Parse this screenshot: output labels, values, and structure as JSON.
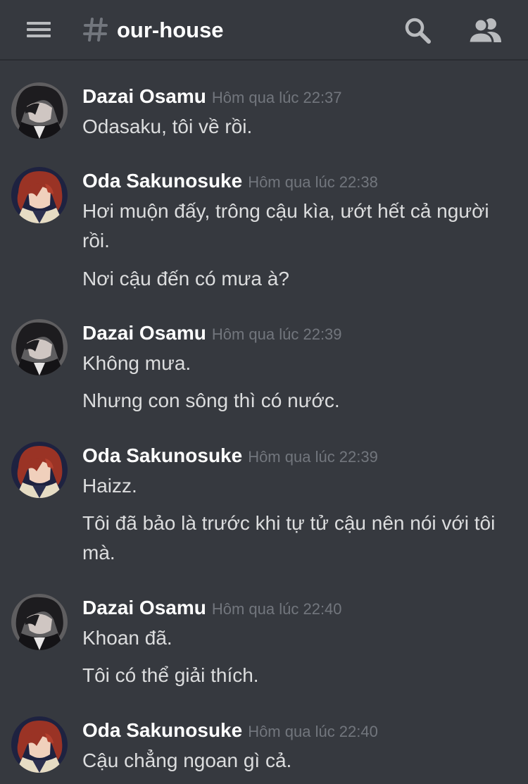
{
  "header": {
    "menu_icon": "hamburger-menu-icon",
    "hash_icon": "hash-icon",
    "channel_name": "our-house",
    "search_icon": "search-icon",
    "members_icon": "members-icon"
  },
  "colors": {
    "background": "#36393f",
    "username": "#ffffff",
    "message_text": "#dcddde",
    "timestamp": "#72767d",
    "header_icons": "#b9bbbe"
  },
  "messages": [
    {
      "author": "Dazai Osamu",
      "avatar": "dazai-avatar",
      "time": "Hôm qua lúc 22:37",
      "lines": [
        "Odasaku, tôi về rồi."
      ]
    },
    {
      "author": "Oda Sakunosuke",
      "avatar": "oda-avatar",
      "time": "Hôm qua lúc 22:38",
      "lines": [
        "Hơi muộn đấy, trông cậu kìa, ướt hết cả người rồi.",
        "Nơi cậu đến có mưa à?"
      ]
    },
    {
      "author": "Dazai Osamu",
      "avatar": "dazai-avatar",
      "time": "Hôm qua lúc 22:39",
      "lines": [
        "Không mưa.",
        "Nhưng con sông thì có nước."
      ]
    },
    {
      "author": "Oda Sakunosuke",
      "avatar": "oda-avatar",
      "time": "Hôm qua lúc 22:39",
      "lines": [
        "Haizz.",
        "Tôi đã bảo là trước khi tự tử cậu nên nói với tôi mà."
      ]
    },
    {
      "author": "Dazai Osamu",
      "avatar": "dazai-avatar",
      "time": "Hôm qua lúc 22:40",
      "lines": [
        "Khoan đã.",
        "Tôi có thể giải thích."
      ]
    },
    {
      "author": "Oda Sakunosuke",
      "avatar": "oda-avatar",
      "time": "Hôm qua lúc 22:40",
      "lines": [
        "Cậu chẳng ngoan gì cả."
      ]
    }
  ]
}
